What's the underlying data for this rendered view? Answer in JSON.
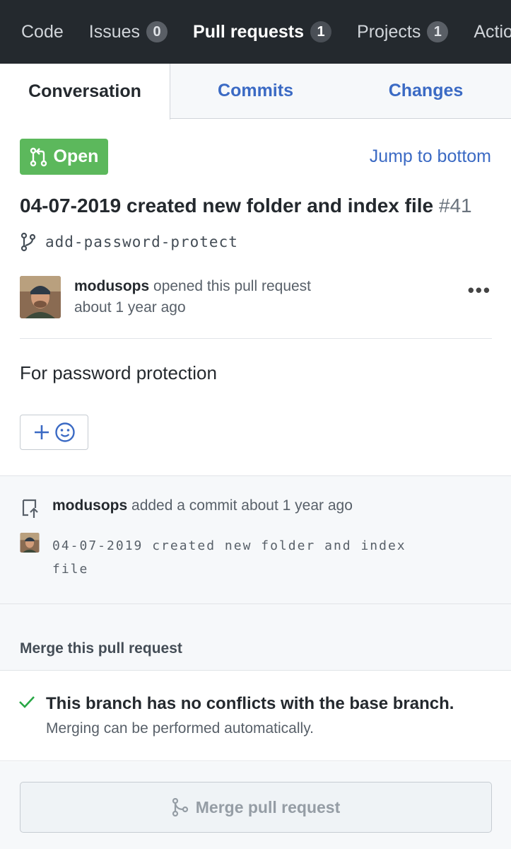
{
  "nav": {
    "items": [
      {
        "label": "Code",
        "count": null
      },
      {
        "label": "Issues",
        "count": "0"
      },
      {
        "label": "Pull requests",
        "count": "1"
      },
      {
        "label": "Projects",
        "count": "1"
      },
      {
        "label": "Actio",
        "count": null
      }
    ]
  },
  "tabs": [
    "Conversation",
    "Commits",
    "Changes"
  ],
  "pr": {
    "state": "Open",
    "jump_link": "Jump to bottom",
    "title": "04-07-2019 created new folder and index file",
    "number": "#41",
    "branch": "add-password-protect"
  },
  "opener": {
    "user": "modusops",
    "action": "opened this pull request",
    "time": "about 1 year ago",
    "more": "•••",
    "body": "For password protection"
  },
  "commit_event": {
    "user": "modusops",
    "action": "added a commit about 1 year ago",
    "message": "04-07-2019 created new folder and index file"
  },
  "merge": {
    "header": "Merge this pull request",
    "status_title": "This branch has no conflicts with the base branch.",
    "status_sub": "Merging can be performed automatically.",
    "button_label": "Merge pull request"
  },
  "colors": {
    "nav_bg": "#24292e",
    "link": "#3b6ac4",
    "open_green": "#5cb85c",
    "check_green": "#28a745"
  }
}
